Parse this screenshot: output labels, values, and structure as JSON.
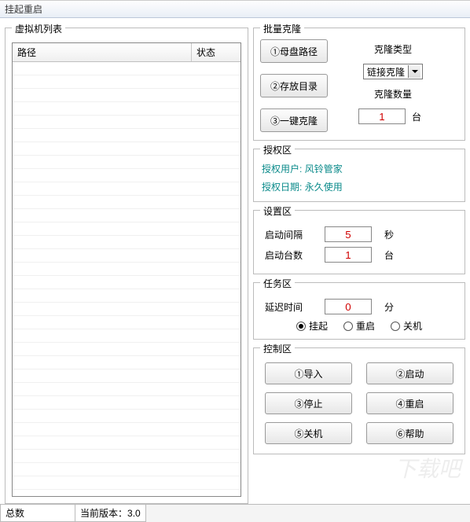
{
  "title": "挂起重启",
  "vm_list": {
    "legend": "虚拟机列表",
    "columns": {
      "path": "路径",
      "status": "状态"
    }
  },
  "clone": {
    "legend": "批量克隆",
    "btn_master": "①母盘路径",
    "btn_storage": "②存放目录",
    "btn_oneclick": "③一键克隆",
    "type_label": "克隆类型",
    "type_value": "链接克隆",
    "count_label": "克隆数量",
    "count_value": "1",
    "count_unit": "台"
  },
  "auth": {
    "legend": "授权区",
    "user_label": "授权用户:",
    "user_value": "风铃管家",
    "date_label": "授权日期:",
    "date_value": "永久使用"
  },
  "settings": {
    "legend": "设置区",
    "interval_label": "启动间隔",
    "interval_value": "5",
    "interval_unit": "秒",
    "count_label": "启动台数",
    "count_value": "1",
    "count_unit": "台"
  },
  "task": {
    "legend": "任务区",
    "delay_label": "延迟时间",
    "delay_value": "0",
    "delay_unit": "分",
    "radio_suspend": "挂起",
    "radio_restart": "重启",
    "radio_shutdown": "关机",
    "selected": "suspend"
  },
  "control": {
    "legend": "控制区",
    "btn_import": "①导入",
    "btn_start": "②启动",
    "btn_stop": "③停止",
    "btn_restart": "④重启",
    "btn_shutdown": "⑤关机",
    "btn_help": "⑥帮助"
  },
  "status": {
    "total_label": "总数",
    "version_label": "当前版本：",
    "version_value": "3.0"
  }
}
